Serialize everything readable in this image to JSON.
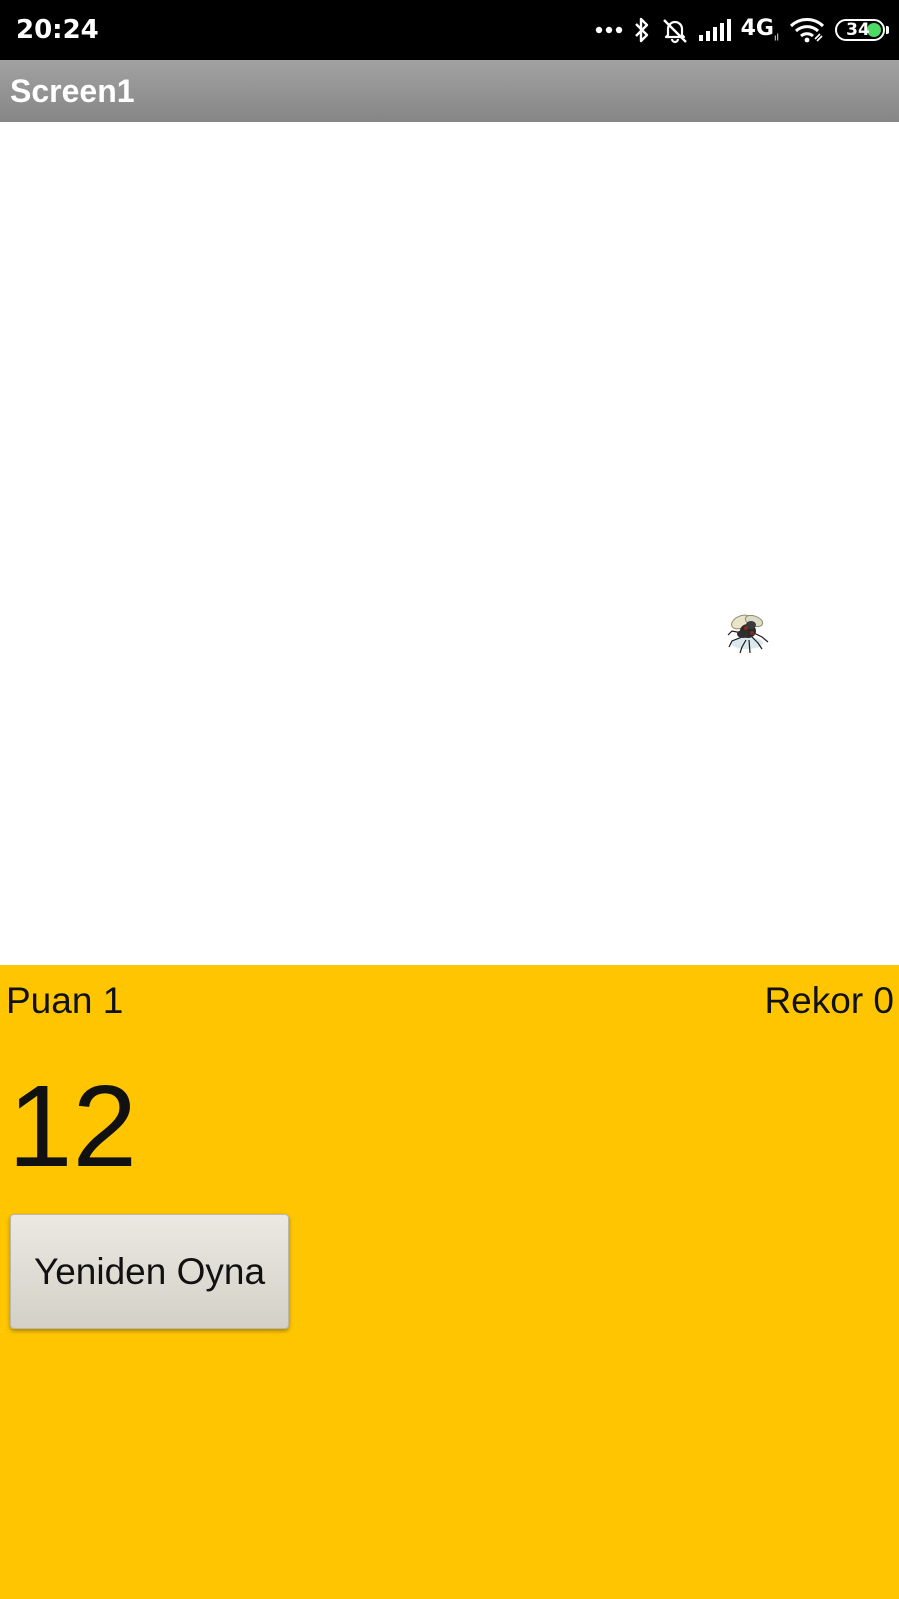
{
  "status_bar": {
    "time": "20:24",
    "network": "4G",
    "network_sub": "ıl",
    "battery": "34",
    "icons": [
      "more-dots-icon",
      "bluetooth-icon",
      "alarm-off-icon",
      "signal-icon",
      "wifi-icon",
      "battery-icon"
    ],
    "battery_color": "#4cd964"
  },
  "app": {
    "title": "Screen1",
    "title_bar_color": "#8f8f8f"
  },
  "game": {
    "sprite": "fly-icon",
    "score_label": "Puan 1",
    "record_label": "Rekor 0",
    "countdown": "12",
    "replay_button": "Yeniden Oyna",
    "panel_color": "#ffc600"
  }
}
